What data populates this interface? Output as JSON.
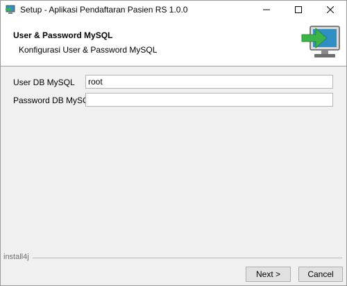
{
  "window": {
    "title": "Setup - Aplikasi Pendaftaran Pasien RS 1.0.0",
    "app_icon": "installer-icon",
    "controls": {
      "minimize": "minimize-icon",
      "maximize": "maximize-icon",
      "close": "close-icon"
    }
  },
  "header": {
    "title": "User & Password MySQL",
    "subtitle": "Konfigurasi User & Password MySQL",
    "graphic": "monitor-arrow-icon"
  },
  "form": {
    "user_label": "User DB MySQL",
    "user_value": "root",
    "password_label": "Password DB MySQL",
    "password_value": ""
  },
  "footer": {
    "brand": "install4j",
    "next_label": "Next >",
    "cancel_label": "Cancel"
  },
  "colors": {
    "window_bg": "#f0f0f0",
    "arrow_green": "#3cb44b",
    "monitor_screen": "#2f8fc4"
  }
}
